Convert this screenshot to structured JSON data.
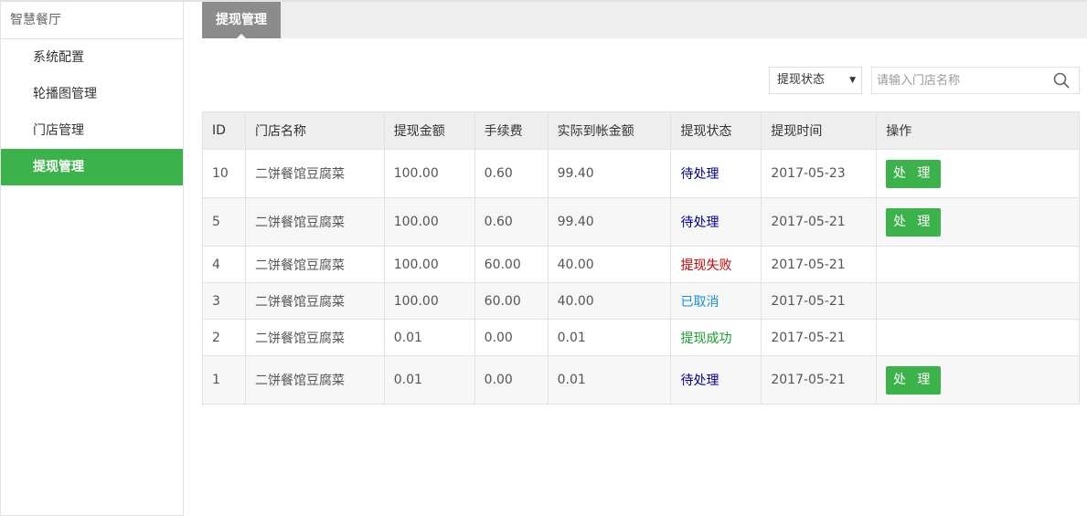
{
  "sidebar": {
    "brand": "智慧餐厅",
    "items": [
      {
        "label": "系统配置",
        "active": false
      },
      {
        "label": "轮播图管理",
        "active": false
      },
      {
        "label": "门店管理",
        "active": false
      },
      {
        "label": "提现管理",
        "active": true
      }
    ]
  },
  "tabs": [
    {
      "label": "提现管理",
      "active": true
    }
  ],
  "filters": {
    "status_select": "提现状态",
    "search_placeholder": "请输入门店名称",
    "search_icon": "search-icon"
  },
  "table": {
    "headers": [
      "ID",
      "门店名称",
      "提现金额",
      "手续费",
      "实际到帐金额",
      "提现状态",
      "提现时间",
      "操作"
    ],
    "rows": [
      {
        "id": "10",
        "store": "二饼餐馆豆腐菜",
        "amount": "100.00",
        "fee": "0.60",
        "actual": "99.40",
        "status": "待处理",
        "status_key": "pending",
        "time": "2017-05-23",
        "action": "处 理"
      },
      {
        "id": "5",
        "store": "二饼餐馆豆腐菜",
        "amount": "100.00",
        "fee": "0.60",
        "actual": "99.40",
        "status": "待处理",
        "status_key": "pending",
        "time": "2017-05-21",
        "action": "处 理"
      },
      {
        "id": "4",
        "store": "二饼餐馆豆腐菜",
        "amount": "100.00",
        "fee": "60.00",
        "actual": "40.00",
        "status": "提现失败",
        "status_key": "fail",
        "time": "2017-05-21",
        "action": ""
      },
      {
        "id": "3",
        "store": "二饼餐馆豆腐菜",
        "amount": "100.00",
        "fee": "60.00",
        "actual": "40.00",
        "status": "已取消",
        "status_key": "cancel",
        "time": "2017-05-21",
        "action": ""
      },
      {
        "id": "2",
        "store": "二饼餐馆豆腐菜",
        "amount": "0.01",
        "fee": "0.00",
        "actual": "0.01",
        "status": "提现成功",
        "status_key": "success",
        "time": "2017-05-21",
        "action": ""
      },
      {
        "id": "1",
        "store": "二饼餐馆豆腐菜",
        "amount": "0.01",
        "fee": "0.00",
        "actual": "0.01",
        "status": "待处理",
        "status_key": "pending",
        "time": "2017-05-21",
        "action": "处 理"
      }
    ]
  },
  "colors": {
    "accent": "#3cb34a",
    "tab_bg": "#8c8c8c",
    "pending": "#0000aa",
    "fail": "#d10000",
    "cancel": "#1a8fd6",
    "success": "#189e27"
  }
}
